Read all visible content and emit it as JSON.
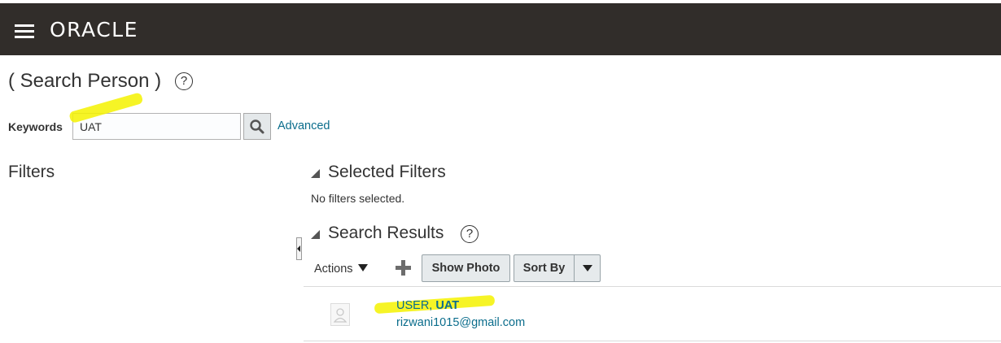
{
  "header": {
    "logo_text": "ORACLE"
  },
  "page": {
    "title": "( Search Person )"
  },
  "search": {
    "keywords_label": "Keywords",
    "keywords_value": "UAT",
    "advanced_link": "Advanced"
  },
  "filters": {
    "title": "Filters"
  },
  "selected_filters": {
    "title": "Selected Filters",
    "empty_text": "No filters selected."
  },
  "results": {
    "title": "Search Results",
    "toolbar": {
      "actions_label": "Actions",
      "show_photo_label": "Show Photo",
      "sort_by_label": "Sort By"
    },
    "items": [
      {
        "last_name": "USER",
        "separator": ", ",
        "first_name": "UAT",
        "email": "rizwani1015@gmail.com"
      }
    ]
  },
  "colors": {
    "header_bg": "#312d2a",
    "link": "#0b6d8c",
    "highlight": "#f5f200"
  },
  "help_icon_glyph": "?"
}
